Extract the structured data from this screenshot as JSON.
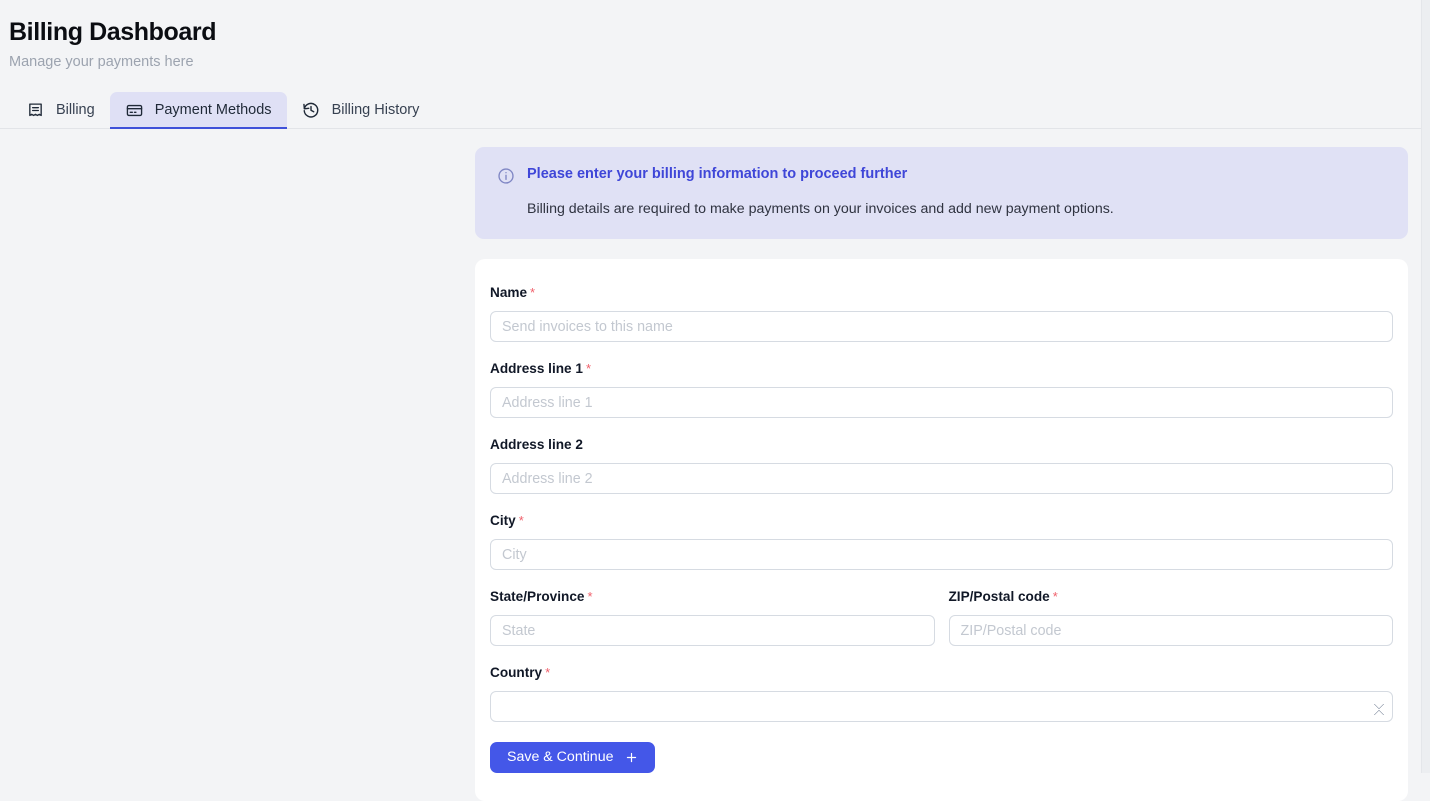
{
  "header": {
    "title": "Billing Dashboard",
    "subtitle": "Manage your payments here"
  },
  "tabs": [
    {
      "label": "Billing",
      "icon": "receipt-icon",
      "active": false
    },
    {
      "label": "Payment Methods",
      "icon": "credit-card-icon",
      "active": true
    },
    {
      "label": "Billing History",
      "icon": "history-icon",
      "active": false
    }
  ],
  "alert": {
    "icon": "info-circle-icon",
    "title": "Please enter your billing information to proceed further",
    "text": "Billing details are required to make payments on your invoices and add new payment options."
  },
  "form": {
    "required_marker": "*",
    "fields": {
      "name": {
        "label": "Name",
        "placeholder": "Send invoices to this name",
        "value": "",
        "required": true
      },
      "address1": {
        "label": "Address line 1",
        "placeholder": "Address line 1",
        "value": "",
        "required": true
      },
      "address2": {
        "label": "Address line 2",
        "placeholder": "Address line 2",
        "value": "",
        "required": false
      },
      "city": {
        "label": "City",
        "placeholder": "City",
        "value": "",
        "required": true
      },
      "state": {
        "label": "State/Province",
        "placeholder": "State",
        "value": "",
        "required": true
      },
      "zip": {
        "label": "ZIP/Postal code",
        "placeholder": "ZIP/Postal code",
        "value": "",
        "required": true
      },
      "country": {
        "label": "Country",
        "value": "",
        "required": true,
        "options": [
          ""
        ]
      }
    },
    "submit": {
      "label": "Save & Continue",
      "icon": "plus-icon"
    }
  },
  "colors": {
    "page_background": "#f3f4f6",
    "accent_blue": "#4457e8",
    "alert_background": "#e0e1f5",
    "alert_title": "#3f46d8",
    "active_tab_background": "#dfe0f5",
    "required_asterisk": "#f0606b",
    "input_border": "#d6dbe2",
    "subtitle_gray": "#9ca3af"
  }
}
